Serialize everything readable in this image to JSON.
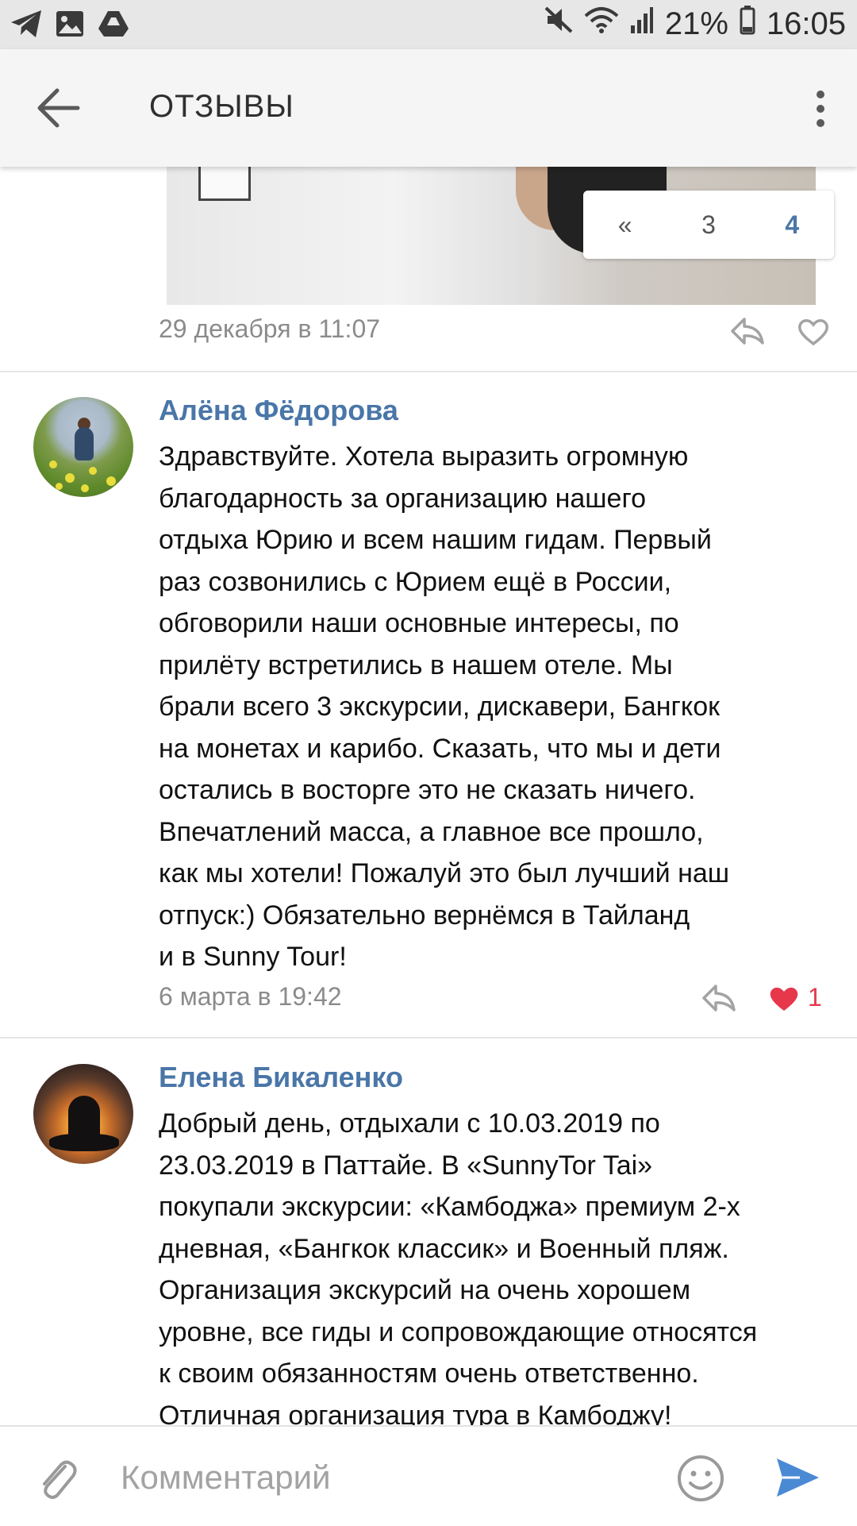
{
  "status_bar": {
    "battery": "21%",
    "time": "16:05",
    "left_icons": [
      "telegram-icon",
      "image-icon",
      "drive-icon"
    ],
    "right_icons": [
      "mute-icon",
      "wifi-icon",
      "signal-icon",
      "battery-icon"
    ]
  },
  "app_bar": {
    "title": "ОТЗЫВЫ",
    "back_icon": "back-arrow-icon",
    "menu_icon": "more-vertical-icon"
  },
  "photo_post": {
    "pagination": [
      "«",
      "3",
      "4"
    ],
    "active_page": "4",
    "timestamp": "29 декабря в 11:07"
  },
  "reviews": [
    {
      "author": "Алёна Фёдорова",
      "lines": [
        "Здравствуйте. Хотела выразить огромную",
        "благодарность за организацию нашего",
        "отдыха Юрию и всем нашим гидам. Первый",
        "раз созвонились с Юрием ещё в России,",
        "обговорили наши основные интересы, по",
        "прилёту встретились в нашем отеле. Мы",
        "брали всего 3 экскурсии, дискавери, Бангкок",
        "на монетах и карибо. Сказать, что мы и дети",
        "остались в восторге это не сказать ничего.",
        "Впечатлений масса, а главное все прошло,",
        "как мы хотели! Пожалуй это был лучший наш",
        "отпуск:) Обязательно вернёмся в Тайланд",
        "и в Sunny Tour!"
      ],
      "timestamp": "6 марта в 19:42",
      "likes": "1",
      "liked": true
    },
    {
      "author": "Елена Бикаленко",
      "lines": [
        "Добрый день, отдыхали с 10.03.2019 по",
        "23.03.2019 в Паттайе. В «SunnyTor Tai»",
        "покупали экскурсии: «Камбоджа» премиум 2-х",
        "дневная, «Бангкок классик» и Военный пляж.",
        "Организация экскурсий на очень хорошем",
        "уровне, все гиды и сопровождающие относятся",
        "к своим обязанностям очень ответственно.",
        "Отличная организация тура в Камбоджу!"
      ]
    }
  ],
  "comment_bar": {
    "placeholder": "Комментарий",
    "icons": [
      "attach-icon",
      "emoji-icon",
      "send-icon"
    ]
  },
  "colors": {
    "accent": "#4a76a8",
    "like": "#e6374b",
    "meta_text": "#8b8b8b"
  }
}
